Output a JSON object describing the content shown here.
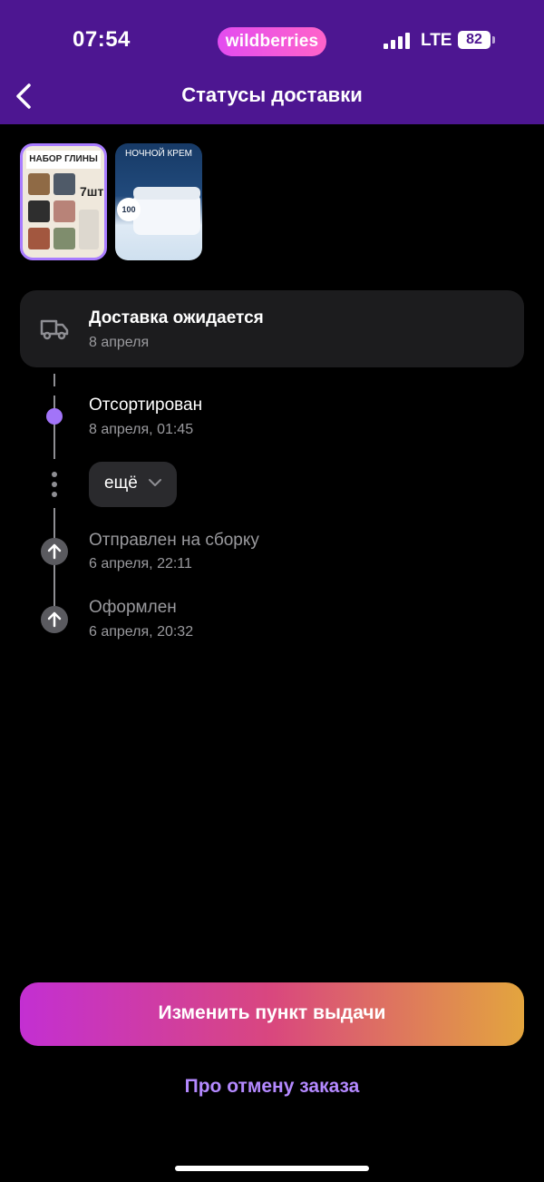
{
  "status_bar": {
    "time": "07:54",
    "brand": "wildberries",
    "network": "LTE",
    "battery": "82"
  },
  "nav": {
    "title": "Статусы доставки",
    "back_icon": "chevron-left-icon"
  },
  "products": [
    {
      "title": "НАБОР ГЛИНЫ",
      "badge": "7шт"
    },
    {
      "title": "НОЧНОЙ КРЕМ",
      "badge": "100"
    }
  ],
  "delivery": {
    "title": "Доставка ожидается",
    "date": "8 апреля",
    "icon": "truck-icon"
  },
  "timeline": {
    "current": {
      "title": "Отсортирован",
      "time": "8 апреля, 01:45"
    },
    "more_label": "ещё",
    "events": [
      {
        "title": "Отправлен на сборку",
        "time": "6 апреля, 22:11"
      },
      {
        "title": "Оформлен",
        "time": "6 апреля, 20:32"
      }
    ]
  },
  "actions": {
    "primary": "Изменить пункт выдачи",
    "secondary": "Про отмену заказа"
  },
  "colors": {
    "header": "#4d1691",
    "accent": "#a274f8",
    "link": "#b489ff"
  }
}
